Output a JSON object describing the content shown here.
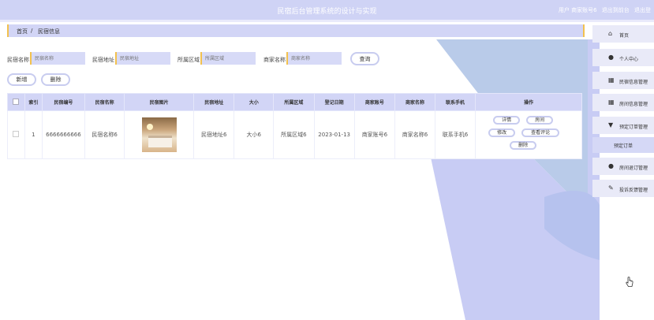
{
  "header": {
    "title": "民宿后台管理系统的设计与实现",
    "user_info": "用户 商家账号6",
    "front_link": "退出到前台",
    "logout": "退出登"
  },
  "breadcrumb": {
    "home": "首页",
    "sep": "/",
    "current": "民宿信息"
  },
  "search": {
    "fields": [
      {
        "label": "民宿名称",
        "placeholder": "民宿名称"
      },
      {
        "label": "民宿地址",
        "placeholder": "民宿地址"
      },
      {
        "label": "所属区域",
        "placeholder": "所属区域"
      },
      {
        "label": "商家名称",
        "placeholder": "商家名称"
      }
    ],
    "query_button": "查询"
  },
  "actions": {
    "add": "新增",
    "delete": "删除"
  },
  "table": {
    "headers": [
      "索引",
      "民宿编号",
      "民宿名称",
      "民宿图片",
      "民宿地址",
      "大小",
      "所属区域",
      "登记日期",
      "商家账号",
      "商家名称",
      "联系手机",
      "操作"
    ],
    "rows": [
      {
        "index": "1",
        "code": "6666666666",
        "name": "民宿名称6",
        "address": "民宿地址6",
        "size": "大小6",
        "region": "所属区域6",
        "date": "2023-01-13",
        "account": "商家账号6",
        "merchant": "商家名称6",
        "phone": "联系手机6",
        "ops": {
          "detail": "详情",
          "room": "房间",
          "edit": "修改",
          "reviews": "查看评论",
          "delete": "删除"
        }
      }
    ]
  },
  "sidebar": {
    "items": [
      {
        "icon": "home-icon",
        "glyph": "⌂",
        "label": "首页"
      },
      {
        "icon": "user-icon",
        "glyph": "●",
        "label": "个人中心"
      },
      {
        "icon": "grid-icon",
        "glyph": "▦",
        "label": "民宿信息管理"
      },
      {
        "icon": "grid-icon",
        "glyph": "▦",
        "label": "房间信息管理"
      },
      {
        "icon": "booking-icon",
        "glyph": "▼",
        "label": "预定订单管理"
      },
      {
        "icon": "user-icon",
        "glyph": "●",
        "label": "房间退订管理"
      },
      {
        "icon": "feedback-icon",
        "glyph": "✎",
        "label": "投诉反馈管理"
      }
    ],
    "sub_item": "预定订单"
  },
  "colors": {
    "accent": "#cfd3f5",
    "border_accent": "#f2c14e",
    "shape": "#c5c9f4"
  }
}
